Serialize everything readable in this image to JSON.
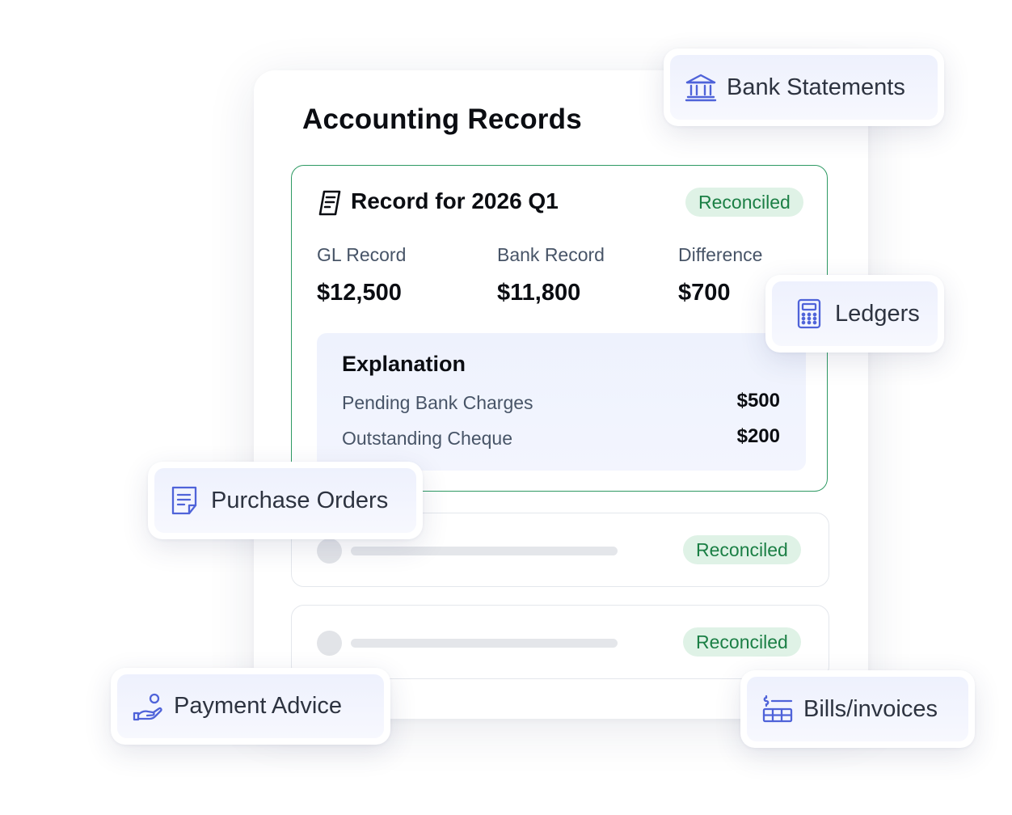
{
  "page": {
    "title": "Accounting Records"
  },
  "record": {
    "title": "Record for 2026 Q1",
    "status": "Reconciled",
    "metrics": [
      {
        "label": "GL Record",
        "value": "$12,500"
      },
      {
        "label": "Bank Record",
        "value": "$11,800"
      },
      {
        "label": "Difference",
        "value": "$700"
      }
    ],
    "explanation": {
      "title": "Explanation",
      "items": [
        {
          "label": "Pending Bank Charges",
          "amount": "$500"
        },
        {
          "label": "Outstanding Cheque",
          "amount": "$200"
        }
      ]
    }
  },
  "collapsed_records": [
    {
      "status": "Reconciled"
    },
    {
      "status": "Reconciled"
    }
  ],
  "chips": {
    "bank_statements": {
      "label": "Bank Statements",
      "icon": "bank-icon"
    },
    "ledgers": {
      "label": "Ledgers",
      "icon": "calculator-icon"
    },
    "purchase_orders": {
      "label": "Purchase Orders",
      "icon": "document-icon"
    },
    "payment_advice": {
      "label": "Payment Advice",
      "icon": "hand-coin-icon"
    },
    "bills_invoices": {
      "label": "Bills/invoices",
      "icon": "invoice-list-icon"
    }
  },
  "colors": {
    "accent_icon": "#4f63d9",
    "reconciled_bg": "#dff2e6",
    "reconciled_text": "#1b7f45",
    "record_border": "#2e9a63"
  }
}
